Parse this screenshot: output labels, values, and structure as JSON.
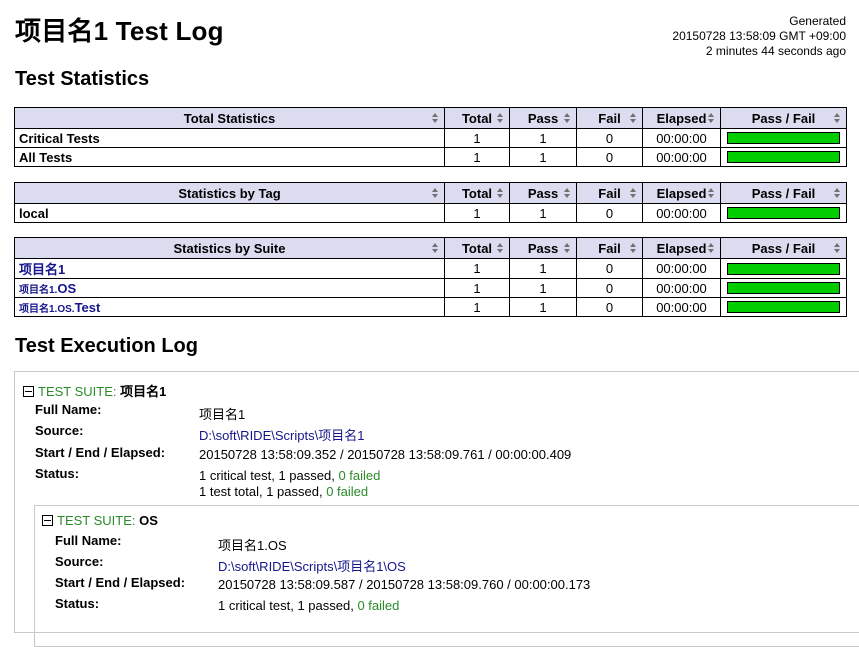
{
  "header": {
    "title": "项目名1 Test Log",
    "generated_label": "Generated",
    "generated_time": "20150728 13:58:09 GMT +09:00",
    "generated_ago": "2 minutes 44 seconds ago"
  },
  "statistics": {
    "heading": "Test Statistics",
    "columns": [
      "Total",
      "Pass",
      "Fail",
      "Elapsed",
      "Pass / Fail"
    ],
    "total": {
      "title": "Total Statistics",
      "rows": [
        {
          "name": "Critical Tests",
          "total": "1",
          "pass": "1",
          "fail": "0",
          "elapsed": "00:00:00",
          "pass_ratio": 1.0
        },
        {
          "name": "All Tests",
          "total": "1",
          "pass": "1",
          "fail": "0",
          "elapsed": "00:00:00",
          "pass_ratio": 1.0
        }
      ]
    },
    "tag": {
      "title": "Statistics by Tag",
      "rows": [
        {
          "name": "local",
          "total": "1",
          "pass": "1",
          "fail": "0",
          "elapsed": "00:00:00",
          "pass_ratio": 1.0
        }
      ]
    },
    "suite": {
      "title": "Statistics by Suite",
      "rows": [
        {
          "parent": "",
          "name": "项目名1",
          "total": "1",
          "pass": "1",
          "fail": "0",
          "elapsed": "00:00:00",
          "pass_ratio": 1.0
        },
        {
          "parent": "项目名1.",
          "name": "OS",
          "total": "1",
          "pass": "1",
          "fail": "0",
          "elapsed": "00:00:00",
          "pass_ratio": 1.0
        },
        {
          "parent": "项目名1.OS.",
          "name": "Test",
          "total": "1",
          "pass": "1",
          "fail": "0",
          "elapsed": "00:00:00",
          "pass_ratio": 1.0
        }
      ]
    }
  },
  "execution": {
    "heading": "Test Execution Log",
    "labels": {
      "suite": "TEST SUITE:",
      "full_name": "Full Name:",
      "source": "Source:",
      "times": "Start / End / Elapsed:",
      "status": "Status:"
    },
    "suite": {
      "name": "项目名1",
      "full_name": "项目名1",
      "source": "D:\\soft\\RIDE\\Scripts\\项目名1",
      "times": "20150728 13:58:09.352 / 20150728 13:58:09.761 / 00:00:00.409",
      "status1": "1 critical test, 1 passed, ",
      "status1_failed": "0 failed",
      "status2": "1 test total, 1 passed, ",
      "status2_failed": "0 failed"
    },
    "child": {
      "name": "OS",
      "full_name": "项目名1.OS",
      "source": "D:\\soft\\RIDE\\Scripts\\项目名1\\OS",
      "times": "20150728 13:58:09.587 / 20150728 13:58:09.760 / 00:00:00.173",
      "status1": "1 critical test, 1 passed, ",
      "status1_failed": "0 failed"
    }
  }
}
